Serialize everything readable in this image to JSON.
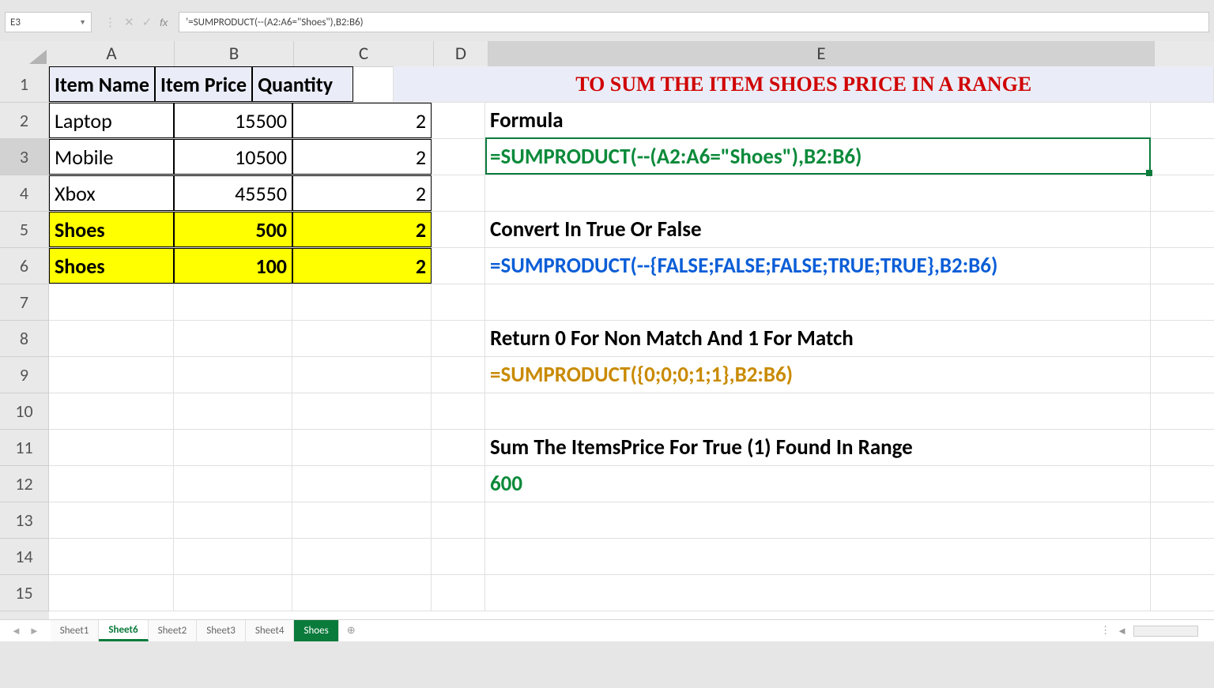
{
  "formula_bar": {
    "name_box": "E3",
    "formula": "'=SUMPRODUCT(--(A2:A6=\"Shoes\"),B2:B6)"
  },
  "columns": [
    "A",
    "B",
    "C",
    "D",
    "E"
  ],
  "rows": [
    "1",
    "2",
    "3",
    "4",
    "5",
    "6",
    "7",
    "8",
    "9",
    "10",
    "11",
    "12",
    "13",
    "14",
    "15"
  ],
  "active_column_idx": 4,
  "active_row_idx": 2,
  "table": {
    "headers": [
      "Item Name",
      "Item Price",
      "Quantity"
    ],
    "rows": [
      {
        "name": "Laptop",
        "price": "15500",
        "qty": "2",
        "hl": false
      },
      {
        "name": "Mobile",
        "price": "10500",
        "qty": "2",
        "hl": false
      },
      {
        "name": "Xbox",
        "price": "45550",
        "qty": "2",
        "hl": false
      },
      {
        "name": "Shoes",
        "price": "500",
        "qty": "2",
        "hl": true
      },
      {
        "name": "Shoes",
        "price": "100",
        "qty": "2",
        "hl": true
      }
    ]
  },
  "colE": {
    "title": "TO SUM THE ITEM SHOES PRICE IN A RANGE",
    "label_formula": "Formula",
    "formula_green": "=SUMPRODUCT(--(A2:A6=\"Shoes\"),B2:B6)",
    "label_convert": "Convert In True Or False",
    "formula_blue": "=SUMPRODUCT(--{FALSE;FALSE;FALSE;TRUE;TRUE},B2:B6)",
    "label_return": "Return 0 For Non Match And 1 For Match",
    "formula_gold": "=SUMPRODUCT({0;0;0;1;1},B2:B6)",
    "label_sum": "Sum The ItemsPrice For True (1) Found In Range",
    "result": "600"
  },
  "sheet_tabs": {
    "items": [
      "Sheet1",
      "Sheet6",
      "Sheet2",
      "Sheet3",
      "Sheet4",
      "Shoes"
    ],
    "active": "Sheet6",
    "green": "Shoes"
  }
}
